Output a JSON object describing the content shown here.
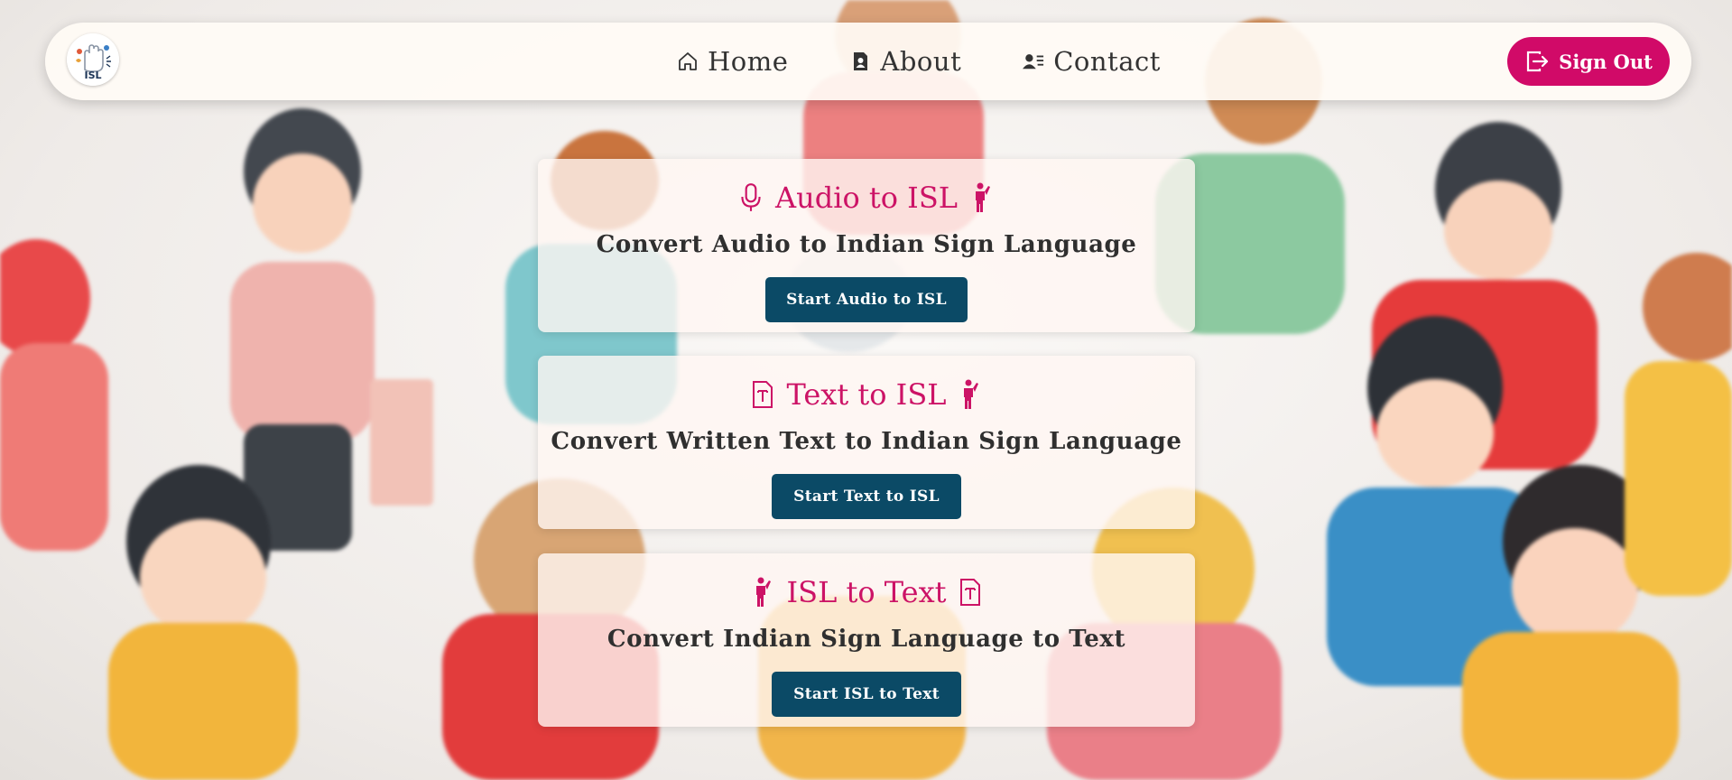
{
  "brand": {
    "logo_text": "ISL"
  },
  "nav": {
    "items": [
      {
        "label": "Home",
        "icon": "home-icon"
      },
      {
        "label": "About",
        "icon": "about-icon"
      },
      {
        "label": "Contact",
        "icon": "contact-icon"
      }
    ],
    "signout_label": "Sign Out"
  },
  "cards": [
    {
      "title": "Audio to ISL",
      "subtitle": "Convert Audio to Indian Sign Language",
      "button": "Start Audio to ISL"
    },
    {
      "title": "Text to ISL",
      "subtitle": "Convert Written Text to Indian Sign Language",
      "button": "Start Text to ISL"
    },
    {
      "title": "ISL to Text",
      "subtitle": "Convert Indian Sign Language to Text",
      "button": "Start ISL to Text"
    }
  ],
  "colors": {
    "accent": "#cc1366",
    "signout": "#d10a68",
    "button": "#0b4a66",
    "text": "#2f2f2f"
  }
}
